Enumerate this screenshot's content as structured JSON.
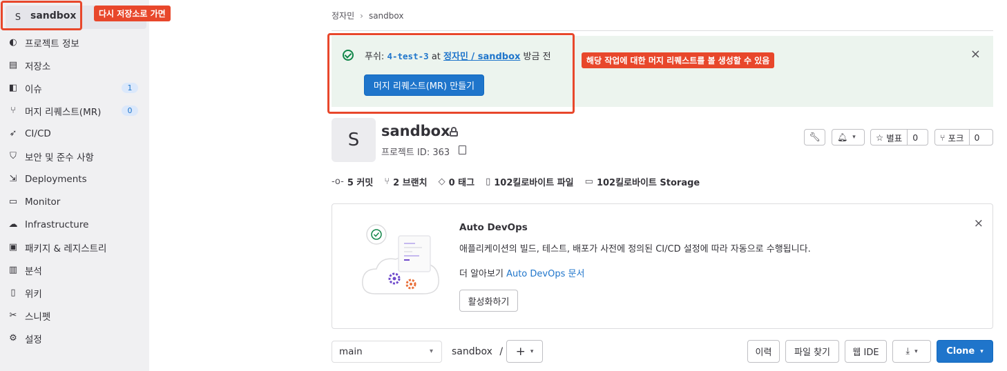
{
  "sidebar": {
    "project_avatar": "S",
    "project_name": "sandbox",
    "items": [
      {
        "label": "프로젝트 정보",
        "icon": "project-info-icon",
        "glyph": "◐"
      },
      {
        "label": "저장소",
        "icon": "repository-icon",
        "glyph": "▤"
      },
      {
        "label": "이슈",
        "icon": "issues-icon",
        "glyph": "◧",
        "badge": "1"
      },
      {
        "label": "머지 리퀘스트(MR)",
        "icon": "merge-request-icon",
        "glyph": "⑂",
        "badge": "0"
      },
      {
        "label": "CI/CD",
        "icon": "rocket-icon",
        "glyph": "➶"
      },
      {
        "label": "보안 및 준수 사항",
        "icon": "shield-icon",
        "glyph": "⛉"
      },
      {
        "label": "Deployments",
        "icon": "deployments-icon",
        "glyph": "⇲"
      },
      {
        "label": "Monitor",
        "icon": "monitor-icon",
        "glyph": "▭"
      },
      {
        "label": "Infrastructure",
        "icon": "cloud-gear-icon",
        "glyph": "☁"
      },
      {
        "label": "패키지 & 레지스트리",
        "icon": "package-icon",
        "glyph": "▣"
      },
      {
        "label": "분석",
        "icon": "chart-icon",
        "glyph": "▥"
      },
      {
        "label": "위키",
        "icon": "book-icon",
        "glyph": "▯"
      },
      {
        "label": "스니펫",
        "icon": "scissors-icon",
        "glyph": "✂"
      },
      {
        "label": "설정",
        "icon": "gear-icon",
        "glyph": "⚙"
      }
    ]
  },
  "annotations": {
    "back_to_repo": "다시 저장소로 가면",
    "mr_possible": "해당 작업에 대한 머지 리퀘스트를 볼 생성할 수 있음"
  },
  "breadcrumb": {
    "owner": "정자민",
    "separator": "›",
    "project": "sandbox"
  },
  "push_alert": {
    "prefix": "푸쉬:",
    "branch": "4-test-3",
    "at": "at",
    "repo_link": "정자민 / sandbox",
    "time": "방금 전",
    "button": "머지 리퀘스트(MR) 만들기",
    "close": "×"
  },
  "project": {
    "avatar": "S",
    "name": "sandbox",
    "id_text": "프로젝트 ID: 363",
    "actions": {
      "star_label": "별표",
      "star_count": "0",
      "fork_label": "포크",
      "fork_count": "0"
    }
  },
  "stats": [
    {
      "icon": "commit-icon",
      "glyph": "-o-",
      "text": "5 커밋"
    },
    {
      "icon": "branch-icon",
      "glyph": "⑂",
      "text": "2 브랜치"
    },
    {
      "icon": "tag-icon",
      "glyph": "◇",
      "text": "0 태그"
    },
    {
      "icon": "file-icon",
      "glyph": "▯",
      "text": "102킬로바이트 파일"
    },
    {
      "icon": "storage-icon",
      "glyph": "▭",
      "text": "102킬로바이트 Storage"
    }
  ],
  "autodevops": {
    "title": "Auto DevOps",
    "description": "애플리케이션의 빌드, 테스트, 배포가 사전에 정의된 CI/CD 설정에 따라 자동으로 수행됩니다.",
    "learn_prefix": "더 알아보기",
    "learn_link": "Auto DevOps 문서",
    "enable_button": "활성화하기",
    "close": "×"
  },
  "repo_bar": {
    "branch": "main",
    "path": "sandbox",
    "path_sep": "/",
    "add": "+",
    "history": "이력",
    "find_file": "파일 찾기",
    "web_ide": "웹 IDE",
    "clone": "Clone"
  },
  "colors": {
    "annotation_red": "#e8472b",
    "primary_blue": "#1f75cb",
    "success_green": "#108548",
    "alert_bg": "#ecf4ee"
  }
}
